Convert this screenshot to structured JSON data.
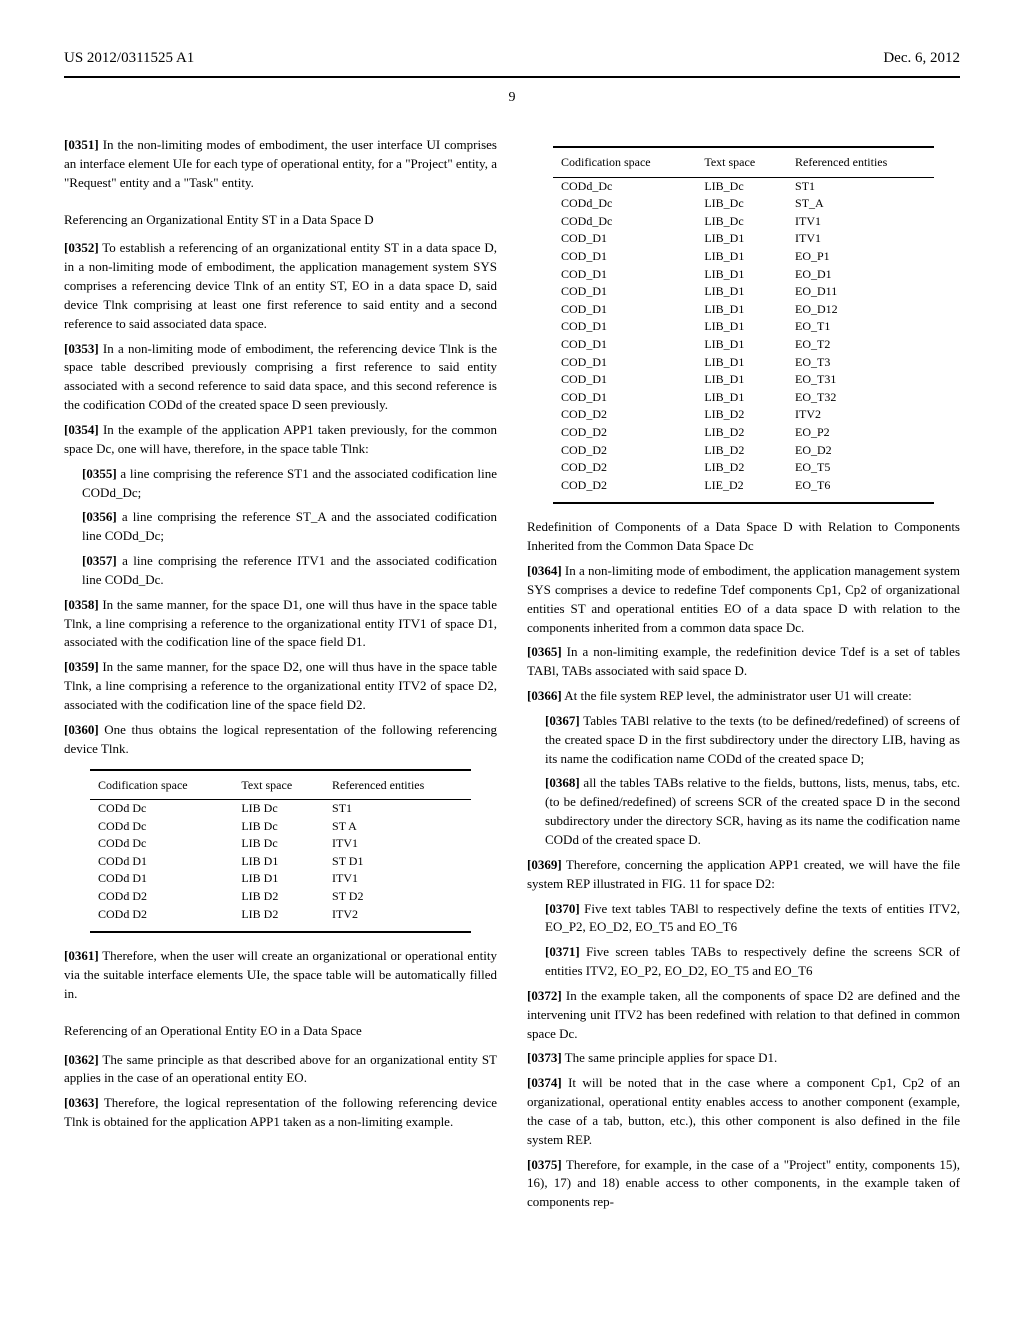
{
  "header": {
    "pubnum": "US 2012/0311525 A1",
    "date": "Dec. 6, 2012",
    "pagenum": "9"
  },
  "left": {
    "p0351": "[0351] In the non-limiting modes of embodiment, the user interface UI comprises an interface element UIe for each type of operational entity, for a \"Project\" entity, a \"Request\" entity and a \"Task\" entity.",
    "secA": "Referencing an Organizational Entity ST in a Data Space D",
    "p0352": "[0352] To establish a referencing of an organizational entity ST in a data space D, in a non-limiting mode of embodiment, the application management system SYS comprises a referencing device Tlnk of an entity ST, EO in a data space D, said device Tlnk comprising at least one first reference to said entity and a second reference to said associated data space.",
    "p0353": "[0353] In a non-limiting mode of embodiment, the referencing device Tlnk is the space table described previously comprising a first reference to said entity associated with a second reference to said data space, and this second reference is the codification CODd of the created space D seen previously.",
    "p0354": "[0354] In the example of the application APP1 taken previously, for the common space Dc, one will have, therefore, in the space table Tlnk:",
    "p0355": "[0355] a line comprising the reference ST1 and the associated codification line CODd_Dc;",
    "p0356": "[0356] a line comprising the reference ST_A and the associated codification line CODd_Dc;",
    "p0357": "[0357] a line comprising the reference ITV1 and the associated codification line CODd_Dc.",
    "p0358": "[0358] In the same manner, for the space D1, one will thus have in the space table Tlnk, a line comprising a reference to the organizational entity ITV1 of space D1, associated with the codification line of the space field D1.",
    "p0359": "[0359] In the same manner, for the space D2, one will thus have in the space table Tlnk, a line comprising a reference to the organizational entity ITV2 of space D2, associated with the codification line of the space field D2.",
    "p0360": "[0360] One thus obtains the logical representation of the following referencing device Tlnk.",
    "p0361": "[0361] Therefore, when the user will create an organizational or operational entity via the suitable interface elements UIe, the space table will be automatically filled in.",
    "secB": "Referencing of an Operational Entity EO in a Data Space",
    "p0362": "[0362] The same principle as that described above for an organizational entity ST applies in the case of an operational entity EO.",
    "p0363": "[0363] Therefore, the logical representation of the following referencing device Tlnk is obtained for the application APP1 taken as a non-limiting example."
  },
  "right": {
    "redefHead": "Redefinition of Components of a Data Space D with Relation to Components Inherited from the Common Data Space Dc",
    "p0364": "[0364] In a non-limiting mode of embodiment, the application management system SYS comprises a device to redefine Tdef components Cp1, Cp2 of organizational entities ST and operational entities EO of a data space D with relation to the components inherited from a common data space Dc.",
    "p0365": "[0365] In a non-limiting example, the redefinition device Tdef is a set of tables TABl, TABs associated with said space D.",
    "p0366": "[0366] At the file system REP level, the administrator user U1 will create:",
    "p0367": "[0367] Tables TABl relative to the texts (to be defined/redefined) of screens of the created space D in the first subdirectory under the directory LIB, having as its name the codification name CODd of the created space D;",
    "p0368": "[0368] all the tables TABs relative to the fields, buttons, lists, menus, tabs, etc. (to be defined/redefined) of screens SCR of the created space D in the second subdirectory under the directory SCR, having as its name the codification name CODd of the created space D.",
    "p0369": "[0369] Therefore, concerning the application APP1 created, we will have the file system REP illustrated in FIG. 11 for space D2:",
    "p0370": "[0370] Five text tables TABl to respectively define the texts of entities ITV2, EO_P2, EO_D2, EO_T5 and EO_T6",
    "p0371": "[0371] Five screen tables TABs to respectively define the screens SCR of entities ITV2, EO_P2, EO_D2, EO_T5 and EO_T6",
    "p0372": "[0372] In the example taken, all the components of space D2 are defined and the intervening unit ITV2 has been redefined with relation to that defined in common space Dc.",
    "p0373": "[0373] The same principle applies for space D1.",
    "p0374": "[0374] It will be noted that in the case where a component Cp1, Cp2 of an organizational, operational entity enables access to another component (example, the case of a tab, button, etc.), this other component is also defined in the file system REP.",
    "p0375": "[0375] Therefore, for example, in the case of a \"Project\" entity, components 15), 16), 17) and 18) enable access to other components, in the example taken of components rep-"
  },
  "table1": {
    "h1": "Codification space",
    "h2": "Text space",
    "h3": "Referenced entities",
    "rows": [
      [
        "CODd Dc",
        "LIB Dc",
        "ST1"
      ],
      [
        "CODd Dc",
        "LIB Dc",
        "ST A"
      ],
      [
        "CODd Dc",
        "LIB Dc",
        "ITV1"
      ],
      [
        "CODd D1",
        "LIB D1",
        "ST D1"
      ],
      [
        "CODd D1",
        "LIB D1",
        "ITV1"
      ],
      [
        "CODd D2",
        "LIB D2",
        "ST D2"
      ],
      [
        "CODd D2",
        "LIB D2",
        "ITV2"
      ]
    ]
  },
  "table2": {
    "h1": "Codification space",
    "h2": "Text space",
    "h3": "Referenced entities",
    "rows": [
      [
        "CODd_Dc",
        "LIB_Dc",
        "ST1"
      ],
      [
        "CODd_Dc",
        "LIB_Dc",
        "ST_A"
      ],
      [
        "CODd_Dc",
        "LIB_Dc",
        "ITV1"
      ],
      [
        "COD_D1",
        "LIB_D1",
        "ITV1"
      ],
      [
        "COD_D1",
        "LIB_D1",
        "EO_P1"
      ],
      [
        "COD_D1",
        "LIB_D1",
        "EO_D1"
      ],
      [
        "COD_D1",
        "LIB_D1",
        "EO_D11"
      ],
      [
        "COD_D1",
        "LIB_D1",
        "EO_D12"
      ],
      [
        "COD_D1",
        "LIB_D1",
        "EO_T1"
      ],
      [
        "COD_D1",
        "LIB_D1",
        "EO_T2"
      ],
      [
        "COD_D1",
        "LIB_D1",
        "EO_T3"
      ],
      [
        "COD_D1",
        "LIB_D1",
        "EO_T31"
      ],
      [
        "COD_D1",
        "LIB_D1",
        "EO_T32"
      ],
      [
        "COD_D2",
        "LIB_D2",
        "ITV2"
      ],
      [
        "COD_D2",
        "LIB_D2",
        "EO_P2"
      ],
      [
        "COD_D2",
        "LIB_D2",
        "EO_D2"
      ],
      [
        "COD_D2",
        "LIB_D2",
        "EO_T5"
      ],
      [
        "COD_D2",
        "LIE_D2",
        "EO_T6"
      ]
    ]
  }
}
